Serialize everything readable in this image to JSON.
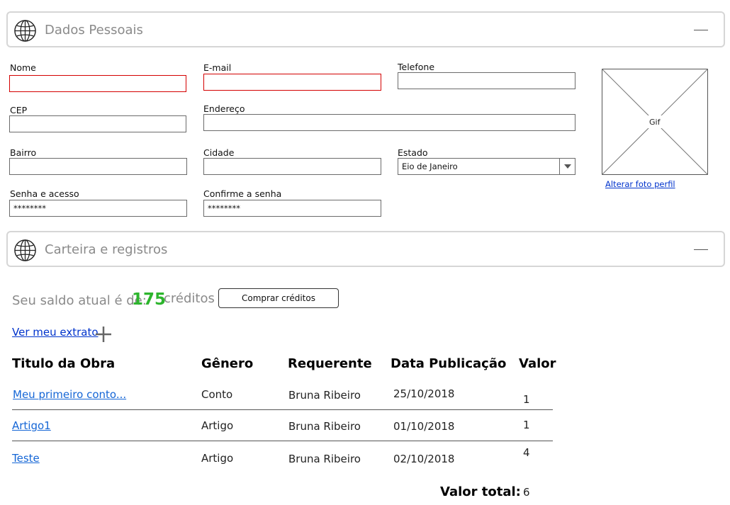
{
  "section_personal": {
    "title": "Dados Pessoais"
  },
  "form": {
    "nome": {
      "label": "Nome",
      "value": ""
    },
    "email": {
      "label": "E-mail",
      "value": ""
    },
    "telefone": {
      "label": "Telefone",
      "value": ""
    },
    "cep": {
      "label": "CEP",
      "value": ""
    },
    "endereco": {
      "label": "Endereço",
      "value": ""
    },
    "bairro": {
      "label": "Bairro",
      "value": ""
    },
    "cidade": {
      "label": "Cidade",
      "value": ""
    },
    "estado": {
      "label": "Estado",
      "value": "Eio de Janeiro"
    },
    "senha": {
      "label": "Senha e acesso",
      "value": "********"
    },
    "confirme": {
      "label": "Confirme a senha",
      "value": "********"
    }
  },
  "photo": {
    "placeholder": "Gif",
    "change_link": "Alterar foto perfil"
  },
  "section_wallet": {
    "title": "Carteira e registros"
  },
  "wallet": {
    "balance_prefix": "Seu saldo atual é de:",
    "balance_value": "175",
    "balance_unit": "créditos",
    "buy_button": "Comprar créditos",
    "statement_link": "Ver meu extrato"
  },
  "table": {
    "headers": [
      "Titulo da Obra",
      "Gênero",
      "Requerente",
      "Data Publicação",
      "Valor"
    ],
    "rows": [
      {
        "titulo": "Meu primeiro conto...",
        "genero": "Conto",
        "requerente": "Bruna Ribeiro",
        "data": "25/10/2018",
        "valor": "1"
      },
      {
        "titulo": "Artigo1",
        "genero": "Artigo",
        "requerente": "Bruna Ribeiro",
        "data": "01/10/2018",
        "valor": "1"
      },
      {
        "titulo": "Teste",
        "genero": "Artigo",
        "requerente": "Bruna Ribeiro",
        "data": "02/10/2018",
        "valor": "4"
      }
    ],
    "total_label": "Valor total:",
    "total_value": "6"
  },
  "colors": {
    "accent_green": "#2db52d",
    "error_red": "#d40000",
    "link_blue": "#0033cc"
  },
  "icons": {
    "section_icon": "globe-icon",
    "collapse_icon": "minus-icon",
    "add_icon": "plus-icon"
  }
}
